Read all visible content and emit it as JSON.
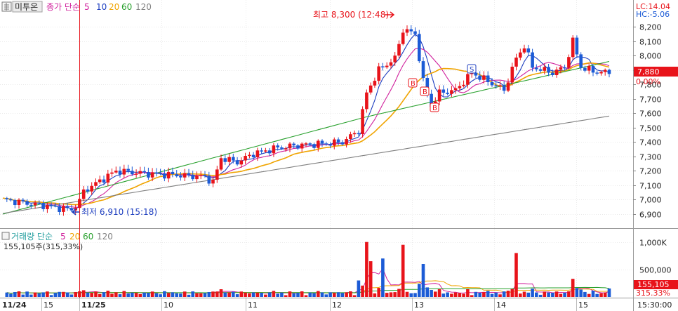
{
  "header": {
    "settings_icon": "grid-icon",
    "stock_name": "미투온",
    "indicator_label": "종가 단순",
    "ma_periods": [
      "5",
      "10",
      "20",
      "60",
      "120"
    ],
    "lc_text": "LC:14.04",
    "hc_text": "HC:-5.06"
  },
  "volume_header": {
    "label": "거래량 단순",
    "ma_periods": [
      "5",
      "20",
      "60",
      "120"
    ],
    "value_text": "155,105주(315,33%)"
  },
  "colors": {
    "up": "#e8131a",
    "down": "#1c5bd6",
    "ma5": "#1c3dbf",
    "ma10": "#d0219d",
    "ma20": "#f0a400",
    "ma60": "#27a02c",
    "ma120": "#808080",
    "price_badge_bg": "#e8131a",
    "date_line": "#e8131a"
  },
  "price_axis_ticks": [
    "8,200",
    "8,100",
    "8,000",
    "7,900",
    "7,800",
    "7,700",
    "7,600",
    "7,500",
    "7,400",
    "7,300",
    "7,200",
    "7,100",
    "7,000",
    "6,900"
  ],
  "volume_axis_ticks": [
    "1,000K",
    "500,000"
  ],
  "current_price_badge": "7,880",
  "current_change_text": "0.00%",
  "volume_badge": "155,105",
  "volume_change_text": "315.33%",
  "annotations": {
    "high_text": "최고 8,300 (12:48)",
    "low_text": "최저 6,910 (15:18)",
    "signal_b": "B",
    "signal_s": "S"
  },
  "time_axis_labels": [
    "11/24",
    "15",
    "11/25",
    "10",
    "11",
    "12",
    "13",
    "14",
    "15",
    "15:30:00"
  ],
  "chart_data": {
    "type": "candlestick",
    "x": [
      "11/24 14:30",
      "11/24 15:00",
      "11/25 09:00",
      "11/25 10:00",
      "11/25 11:00",
      "11/25 12:00",
      "11/25 13:00",
      "11/25 14:00",
      "11/25 15:00",
      "11/25 15:30"
    ],
    "ylim": [
      6880,
      8260
    ],
    "series": [
      {
        "name": "5",
        "values": [
          6990,
          6940,
          6970,
          7180,
          7180,
          7410,
          7960,
          7690,
          7850,
          7880
        ]
      },
      {
        "name": "10",
        "values": [
          6985,
          6955,
          6960,
          7160,
          7170,
          7380,
          7900,
          7720,
          7830,
          7870
        ]
      },
      {
        "name": "20",
        "values": [
          6990,
          6970,
          6965,
          7120,
          7170,
          7340,
          7820,
          7800,
          7820,
          7880
        ]
      },
      {
        "name": "60",
        "values": [
          6920,
          6950,
          6960,
          7050,
          7100,
          7200,
          7450,
          7700,
          7800,
          7880
        ]
      },
      {
        "name": "120",
        "values": [
          6920,
          6930,
          6935,
          6990,
          7030,
          7150,
          7300,
          7450,
          7540,
          7580
        ]
      }
    ],
    "high": {
      "value": 8300,
      "time": "12:48"
    },
    "low": {
      "value": 6910,
      "time": "15:18"
    },
    "last_close": 7880,
    "volume": {
      "ylim": [
        0,
        1150000
      ],
      "last": 155105,
      "last_pct": 315.33,
      "notable_spikes": [
        1000000,
        950000,
        800000,
        700000,
        650000,
        600000
      ]
    }
  }
}
